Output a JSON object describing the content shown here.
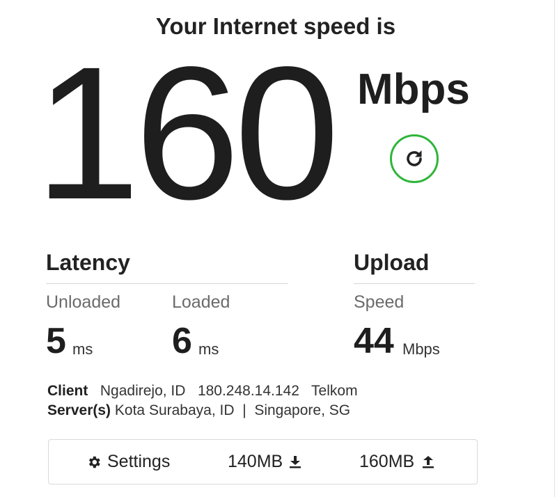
{
  "header": {
    "title": "Your Internet speed is"
  },
  "speed": {
    "value": "160",
    "unit": "Mbps",
    "refresh_icon": "refresh-icon",
    "accent_color": "#2fb53a"
  },
  "latency": {
    "title": "Latency",
    "unloaded_label": "Unloaded",
    "unloaded_value": "5",
    "unloaded_unit": "ms",
    "loaded_label": "Loaded",
    "loaded_value": "6",
    "loaded_unit": "ms"
  },
  "upload": {
    "title": "Upload",
    "speed_label": "Speed",
    "speed_value": "44",
    "speed_unit": "Mbps"
  },
  "client": {
    "label": "Client",
    "location": "Ngadirejo, ID",
    "ip": "180.248.14.142",
    "isp": "Telkom"
  },
  "server": {
    "label": "Server(s)",
    "primary": "Kota Surabaya, ID",
    "separator": "|",
    "secondary": "Singapore, SG"
  },
  "toolbar": {
    "settings_label": "Settings",
    "settings_icon": "gear-icon",
    "download_label": "140MB",
    "download_icon": "download-icon",
    "upload_label": "160MB",
    "upload_icon": "upload-icon"
  }
}
